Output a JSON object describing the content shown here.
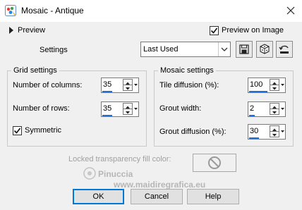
{
  "window": {
    "title": "Mosaic - Antique",
    "icon": "psp-paint-icon",
    "close_icon": "close-icon"
  },
  "preview": {
    "toggle_label": "Preview",
    "preview_on_image_label": "Preview on Image",
    "preview_on_image_checked": true
  },
  "settings": {
    "label": "Settings",
    "preset_value": "Last Used",
    "buttons": [
      "save-preset-icon",
      "randomize-dice-icon",
      "reset-icon"
    ]
  },
  "grid": {
    "title": "Grid settings",
    "columns_label": "Number of columns:",
    "columns_value": "35",
    "rows_label": "Number of rows:",
    "rows_value": "35",
    "symmetric_label": "Symmetric",
    "symmetric_checked": true
  },
  "mosaic": {
    "title": "Mosaic settings",
    "tile_label": "Tile diffusion (%):",
    "tile_value": "100",
    "grout_width_label": "Grout width:",
    "grout_width_value": "2",
    "grout_diffusion_label": "Grout diffusion (%):",
    "grout_diffusion_value": "30"
  },
  "transparency": {
    "label": "Locked transparency fill color:"
  },
  "watermark": {
    "line1": "Pinuccia",
    "line2": "www.maidiregrafica.eu"
  },
  "footer": {
    "ok": "OK",
    "cancel": "Cancel",
    "help": "Help"
  },
  "colors": {
    "accent": "#0078d7",
    "spin_underline": "#1e6fd9"
  }
}
